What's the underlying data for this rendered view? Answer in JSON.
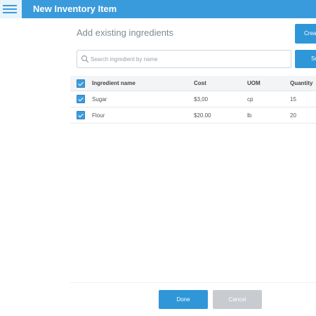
{
  "header": {
    "title": "New Inventory Item",
    "menu_icon": "hamburger-menu-icon"
  },
  "section": {
    "title": "Add existing ingredients",
    "create_label": "Create"
  },
  "search": {
    "placeholder": "Search ingredient by name",
    "value": "",
    "button_label": "Search",
    "icon": "search-icon"
  },
  "table": {
    "columns": [
      "Ingredient name",
      "Cost",
      "UOM",
      "Quantity"
    ],
    "header_checked": true,
    "rows": [
      {
        "checked": true,
        "name": "Sugar",
        "cost": "$3,00",
        "uom": "cp",
        "quantity": "15"
      },
      {
        "checked": true,
        "name": "Flour",
        "cost": "$20.00",
        "uom": "lb",
        "quantity": "20"
      }
    ]
  },
  "footer": {
    "done_label": "Done",
    "cancel_label": "Cancel"
  },
  "colors": {
    "accent": "#3a9bdc",
    "button_primary": "#2f97d8",
    "button_disabled": "#c8ccd0"
  }
}
